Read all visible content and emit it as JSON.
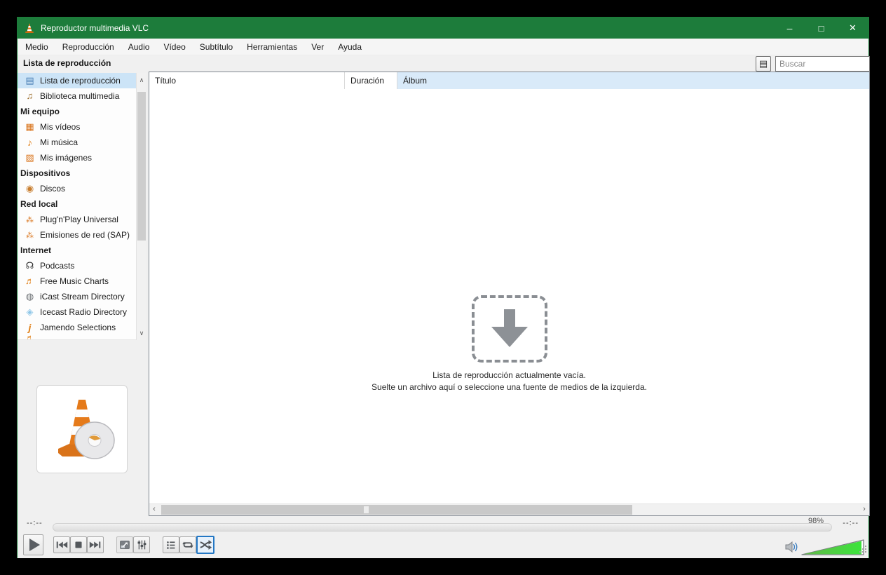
{
  "window": {
    "title": "Reproductor multimedia VLC",
    "minimize_glyph": "–",
    "maximize_glyph": "□",
    "close_glyph": "✕"
  },
  "menu_bar": {
    "items": [
      "Medio",
      "Reproducción",
      "Audio",
      "Vídeo",
      "Subtítulo",
      "Herramientas",
      "Ver",
      "Ayuda"
    ]
  },
  "sidebar": {
    "header": "Lista de reproducción",
    "items": [
      {
        "label": "Lista de reproducción",
        "icon": "playlist-icon",
        "selected": true
      },
      {
        "label": "Biblioteca multimedia",
        "icon": "media-library-icon"
      },
      {
        "label": "Mi equipo",
        "group": true
      },
      {
        "label": "Mis vídeos",
        "icon": "videos-icon"
      },
      {
        "label": "Mi música",
        "icon": "music-icon"
      },
      {
        "label": "Mis imágenes",
        "icon": "images-icon"
      },
      {
        "label": "Dispositivos",
        "group": true
      },
      {
        "label": "Discos",
        "icon": "disc-icon"
      },
      {
        "label": "Red local",
        "group": true
      },
      {
        "label": "Plug'n'Play Universal",
        "icon": "upnp-network-icon"
      },
      {
        "label": "Emisiones de red (SAP)",
        "icon": "network-broadcast-icon"
      },
      {
        "label": "Internet",
        "group": true
      },
      {
        "label": "Podcasts",
        "icon": "podcasts-icon"
      },
      {
        "label": "Free Music Charts",
        "icon": "music-charts-icon"
      },
      {
        "label": "iCast Stream Directory",
        "icon": "globe-icon"
      },
      {
        "label": "Icecast Radio Directory",
        "icon": "radio-waves-icon"
      },
      {
        "label": "Jamendo Selections",
        "icon": "jamendo-icon"
      }
    ]
  },
  "toolbar": {
    "search_placeholder": "Buscar"
  },
  "playlist": {
    "columns": [
      "Título",
      "Duración",
      "Álbum"
    ],
    "empty_line1": "Lista de reproducción actualmente vacía.",
    "empty_line2": "Suelte un archivo aquí o seleccione una fuente de medios de la izquierda."
  },
  "transport": {
    "time_elapsed": "--:--",
    "time_total": "--:--",
    "volume_label": "98%",
    "volume_percent": 98
  },
  "colors": {
    "titlebar_green": "#1d7c3b",
    "selection_blue": "#cce4f7",
    "album_header_blue": "#d9eaf9",
    "volume_green": "#45d83e"
  }
}
